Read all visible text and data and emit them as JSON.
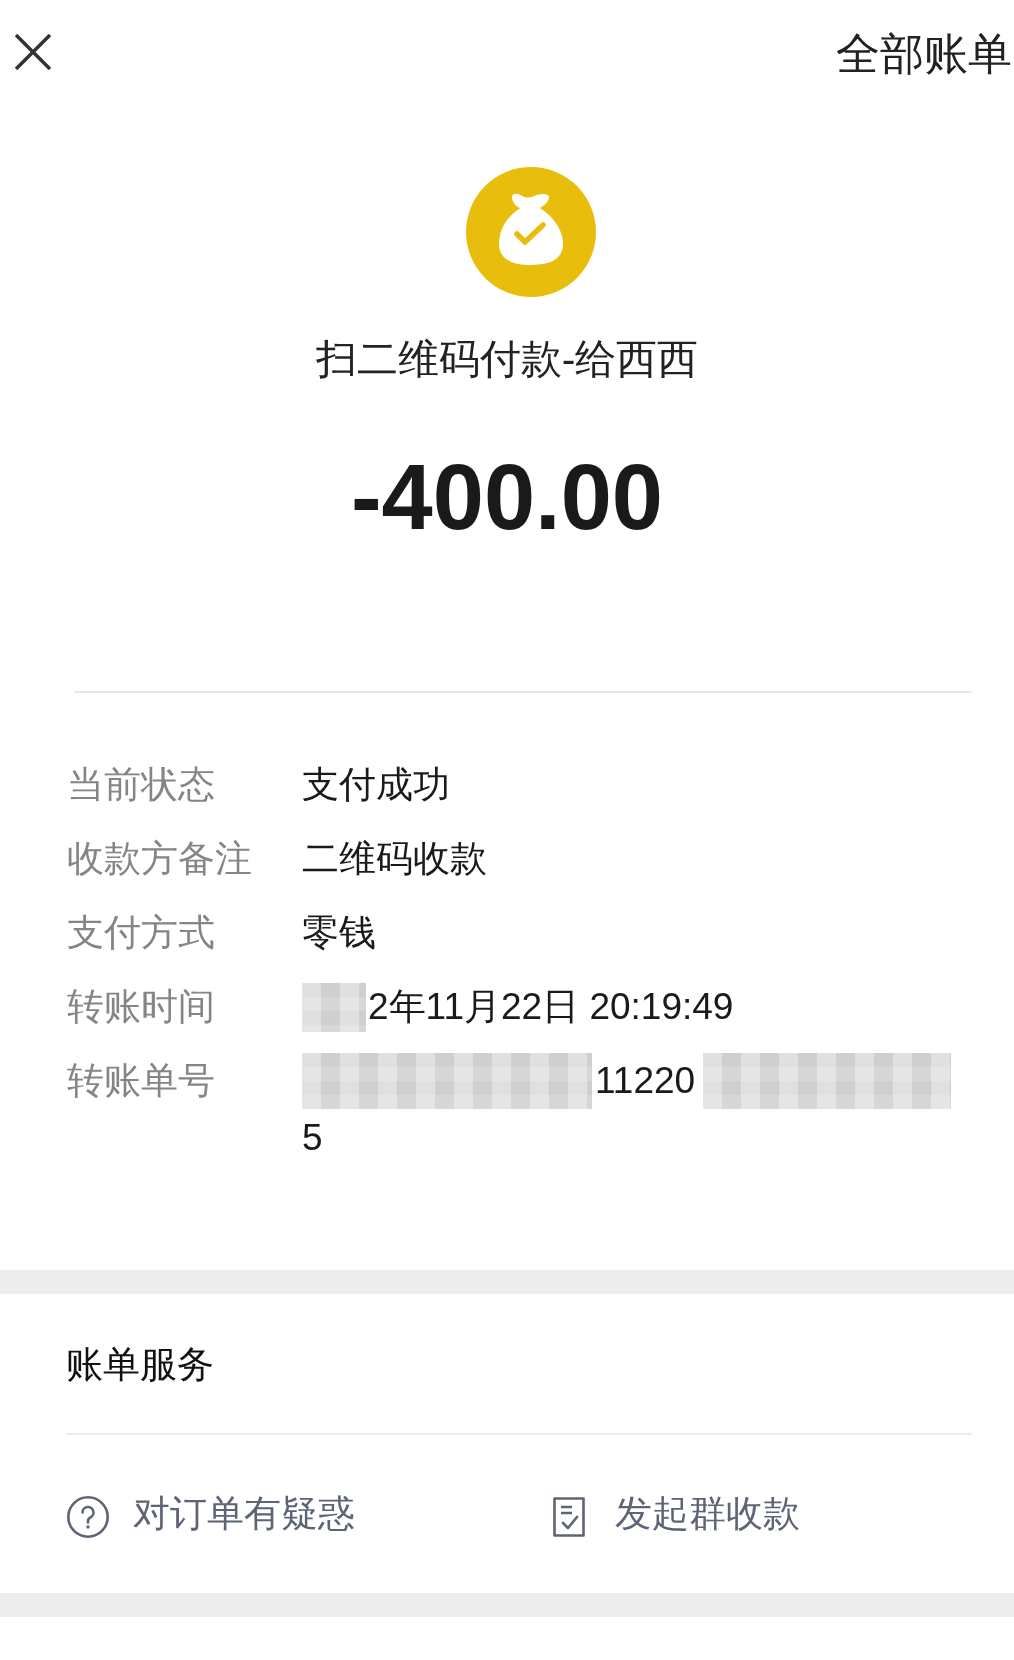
{
  "top_bar": {
    "action": "全部账单"
  },
  "payment": {
    "title": "扫二维码付款-给西西",
    "amount": "-400.00"
  },
  "details": [
    {
      "kind": "text",
      "label": "当前状态",
      "value": "支付成功"
    },
    {
      "kind": "text",
      "label": "收款方备注",
      "value": "二维码收款"
    },
    {
      "kind": "text",
      "label": "支付方式",
      "value": "零钱"
    },
    {
      "kind": "partly_redacted",
      "label": "转账时间",
      "value": "2年11月22日 20:19:49"
    },
    {
      "kind": "redacted",
      "label": "转账单号",
      "fragment": "11220",
      "value": "5"
    }
  ],
  "bill_service": {
    "title": "账单服务",
    "actions": [
      {
        "kind": "help",
        "label": "对订单有疑惑"
      },
      {
        "kind": "group_collect",
        "label": "发起群收款"
      }
    ]
  }
}
